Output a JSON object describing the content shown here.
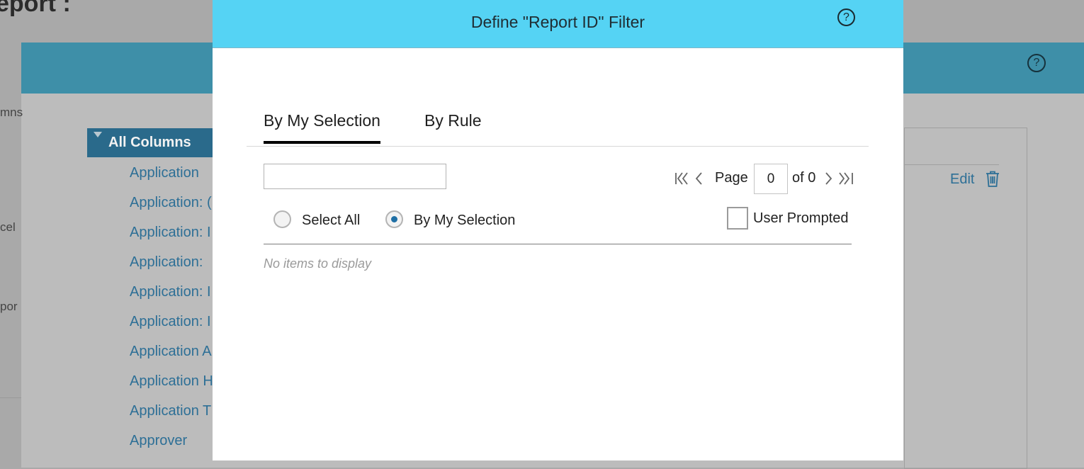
{
  "background": {
    "page_title": "eport :",
    "side_texts": [
      "mns",
      "cel",
      "por"
    ],
    "tree_header": "All Columns",
    "tree_items": [
      "Application",
      "Application: (",
      "Application: I",
      "Application: ",
      "Application: I",
      "Application: I",
      "Application A",
      "Application H",
      "Application T",
      "Approver"
    ],
    "edit_label": "Edit",
    "help_glyph": "?"
  },
  "modal": {
    "title": "Define \"Report ID\" Filter",
    "help_glyph": "?",
    "tabs": [
      {
        "label": "By My Selection",
        "active": true
      },
      {
        "label": "By Rule",
        "active": false
      }
    ],
    "search": {
      "value": "",
      "placeholder": ""
    },
    "pagination": {
      "page_label": "Page",
      "current_page": "0",
      "of_label": "of 0"
    },
    "radio_options": [
      {
        "label": "Select All",
        "selected": false
      },
      {
        "label": "By My Selection",
        "selected": true
      }
    ],
    "user_prompted": {
      "label": "User Prompted",
      "checked": false
    },
    "empty_message": "No items to display"
  },
  "colors": {
    "modal_header": "#55d3f4",
    "tree_header": "#2a6a8b",
    "link_blue": "#2d6f96",
    "overlay_gray": "#a9a9a9"
  },
  "icons": [
    "first-page-icon",
    "previous-page-icon",
    "next-page-icon",
    "last-page-icon",
    "help-icon",
    "trash-icon",
    "expand-caret-icon"
  ]
}
